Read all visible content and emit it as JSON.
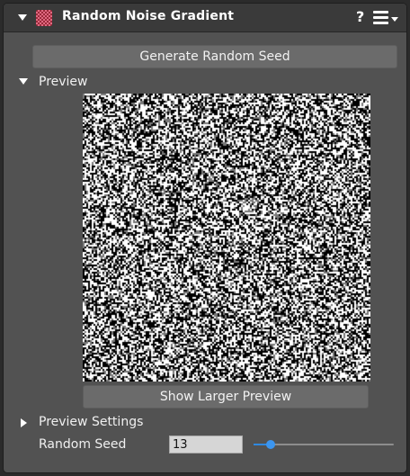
{
  "header": {
    "title": "Random Noise Gradient",
    "help_label": "?",
    "icon": "noise-gradient-icon",
    "menu_icon": "hamburger-menu-icon"
  },
  "buttons": {
    "generate_label": "Generate Random Seed",
    "larger_preview_label": "Show Larger Preview"
  },
  "sections": {
    "preview_label": "Preview",
    "preview_settings_label": "Preview Settings"
  },
  "seed": {
    "label": "Random Seed",
    "value": "13",
    "slider_fraction": 0.12
  },
  "colors": {
    "accent": "#3b95ef",
    "panel_bg": "#525252",
    "header_bg": "#3a3a3a",
    "button_bg": "#6b6b6b"
  }
}
